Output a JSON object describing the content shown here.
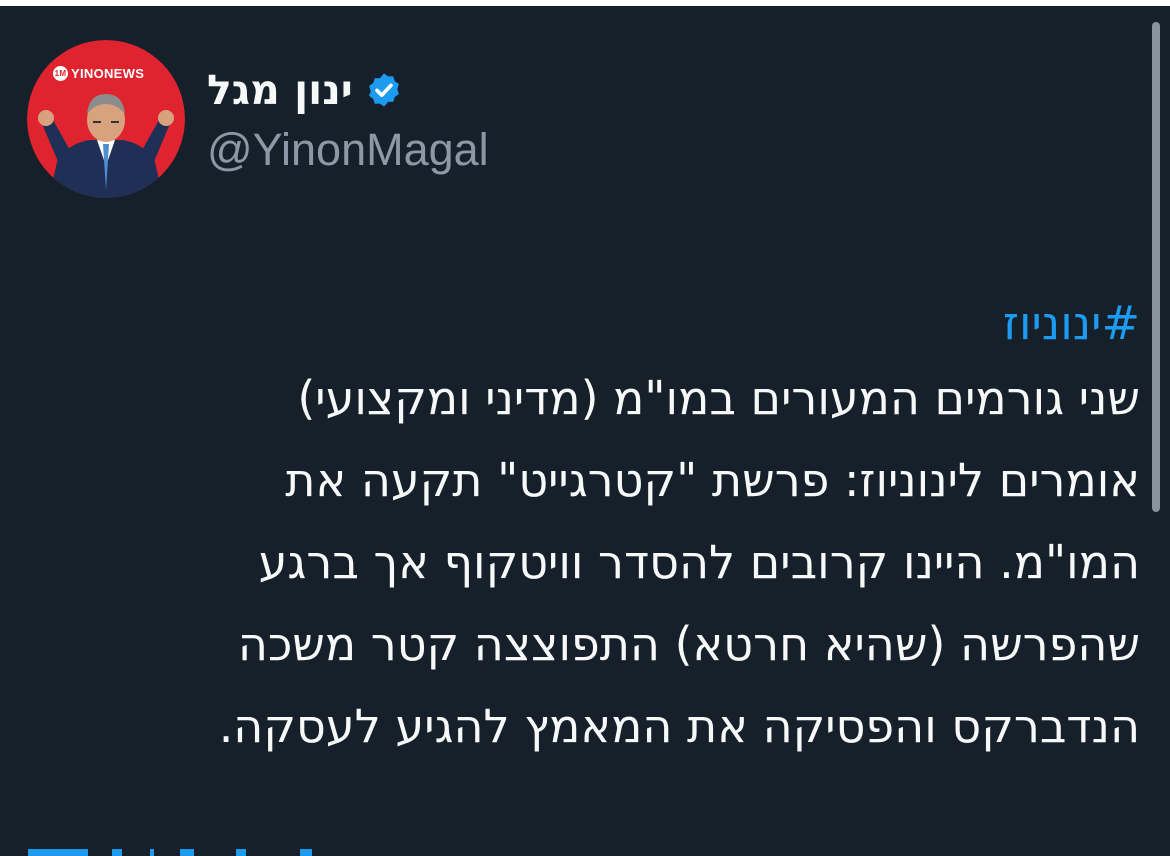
{
  "user": {
    "display_name": "ינון מגל",
    "handle": "@YinonMagal",
    "verified_icon": "verified-badge-icon",
    "avatar_logo_badge": "1M",
    "avatar_logo_text": "YINONEWS"
  },
  "tweet": {
    "hashtag": "#ינוניוז",
    "lines": [
      "שני גורמים המעורים במו\"מ (מדיני ומקצועי)",
      "אומרים לינוניוז: פרשת \"קטרגייט\" תקעה את",
      "המו\"מ. היינו קרובים להסדר וויטקוף אך ברגע",
      "שהפרשה (שהיא חרטא) התפוצצה קטר משכה",
      "הנדברקס והפסיקה את המאמץ להגיע לעסקה."
    ]
  },
  "colors": {
    "background": "#15202b",
    "text": "#f7f9f9",
    "secondary_text": "#8b98a5",
    "accent": "#1d9bf0",
    "avatar_background": "#e0242f"
  }
}
